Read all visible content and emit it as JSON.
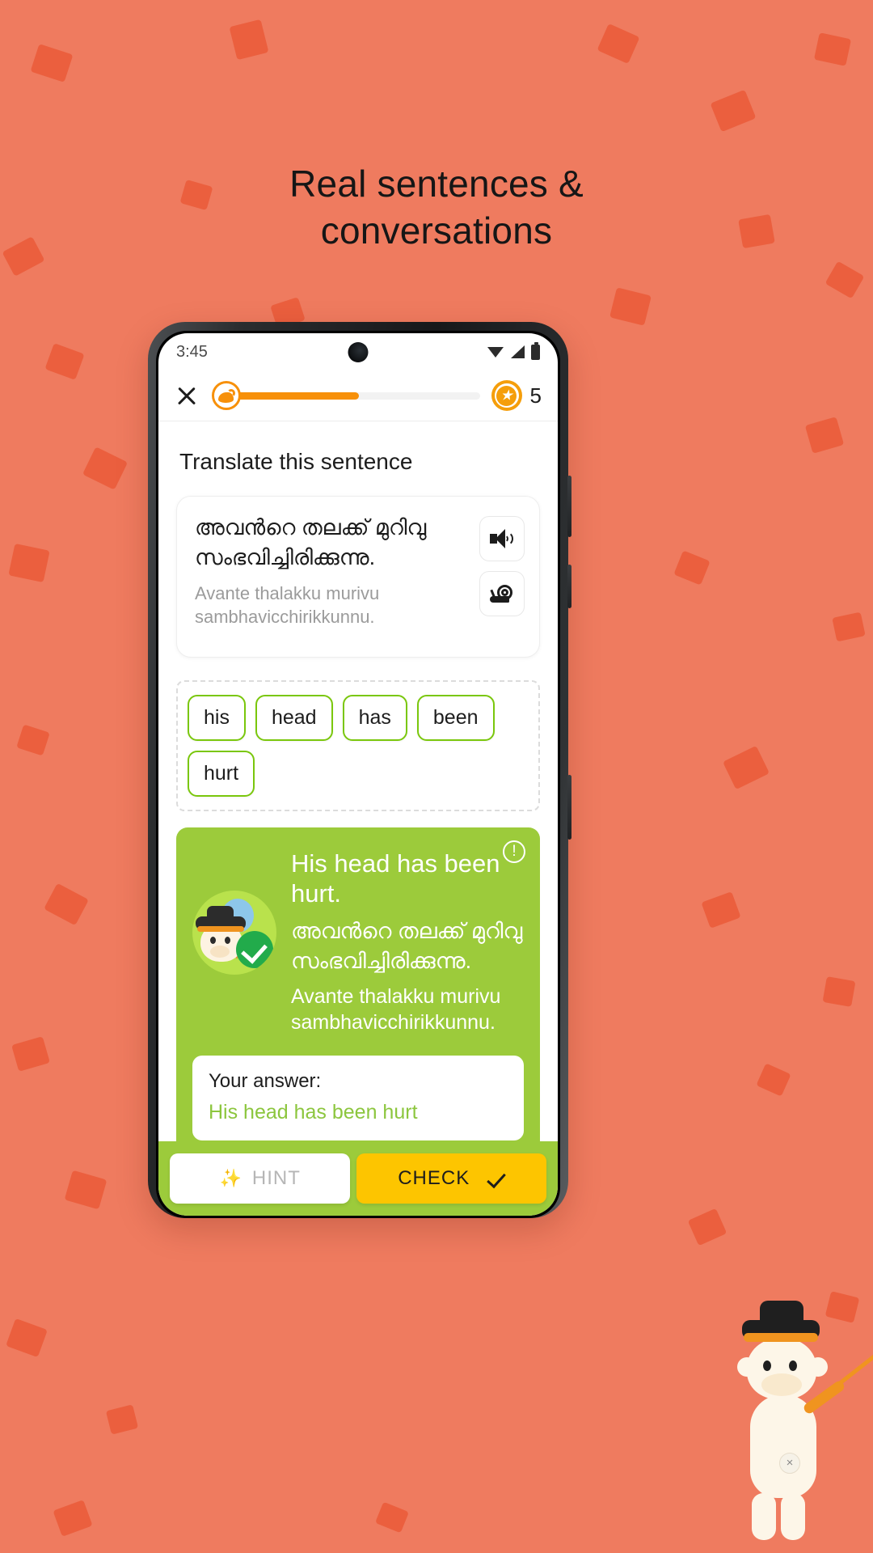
{
  "headline": {
    "line1": "Real sentences &",
    "line2": "conversations"
  },
  "phone": {
    "status": {
      "time": "3:45",
      "wifi_icon": "wifi-icon",
      "signal_icon": "signal-icon",
      "battery_icon": "battery-icon"
    },
    "toolbar": {
      "close_icon": "close-icon",
      "progress_badge_icon": "monkey-badge-icon",
      "progress_percent": 52,
      "coin_icon": "star-coin-icon",
      "coin_count": "5"
    },
    "prompt": "Translate this sentence",
    "question": {
      "native": "അവൻറെ തലക്ക് മുറിവു സംഭവിച്ചിരിക്കുന്നു.",
      "transliteration": "Avante thalakku murivu sambhavicchirikkunnu.",
      "play_icon": "speaker-icon",
      "slow_play_icon": "snail-icon"
    },
    "word_tiles": [
      "his",
      "head",
      "has",
      "been",
      "hurt"
    ],
    "feedback": {
      "info_icon": "info-icon",
      "avatar_icon": "monkey-avatar-icon",
      "check_icon": "check-circle-icon",
      "english": "His head has been hurt.",
      "native": "അവൻറെ തലക്ക് മുറിവു സംഭവിച്ചിരിക്കുന്നു.",
      "transliteration": "Avante thalakku murivu sambhavicchirikkunnu.",
      "answer_label": "Your answer:",
      "answer_value": "His head has been hurt",
      "bg_color": "#9ccb3b"
    },
    "bottom": {
      "hint_label": "HINT",
      "hint_icon": "magic-wand-icon",
      "check_label": "CHECK",
      "check_icon": "checkmark-icon",
      "check_color": "#fdc500"
    }
  },
  "mascot": {
    "icon": "monkey-mascot-icon",
    "badge": "×"
  },
  "colors": {
    "background": "#ef7b5f",
    "confetti": "#ea5a38",
    "accent_orange": "#f79009",
    "accent_green": "#7ac70c"
  }
}
